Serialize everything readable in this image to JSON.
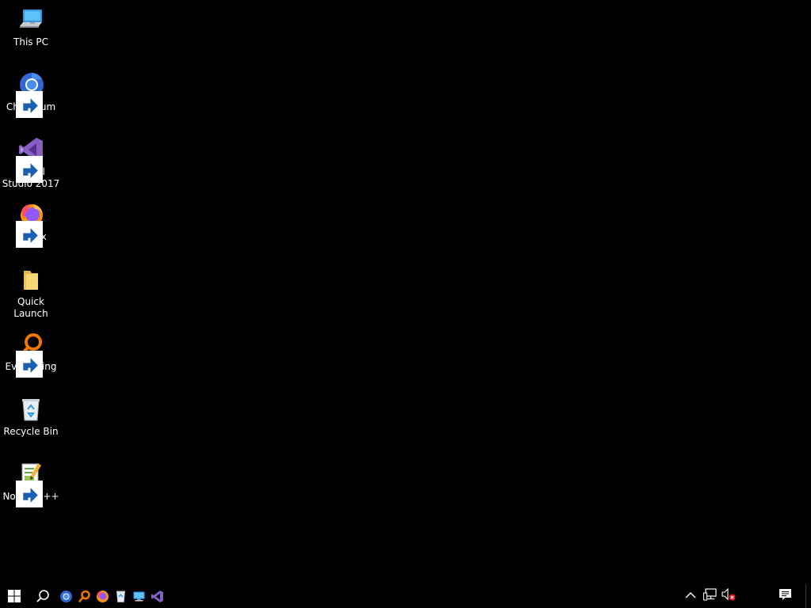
{
  "desktop": {
    "icons": [
      {
        "id": "this-pc",
        "label": "This PC",
        "icon": "computer-icon"
      },
      {
        "id": "chromium",
        "label": "Chromium",
        "icon": "chromium-icon"
      },
      {
        "id": "visual-studio",
        "label": "Visual Studio 2017",
        "icon": "visual-studio-icon"
      },
      {
        "id": "firefox",
        "label": "Firefox",
        "icon": "firefox-icon"
      },
      {
        "id": "quick-launch",
        "label": "Quick Launch",
        "icon": "folder-icon"
      },
      {
        "id": "everything",
        "label": "Everything",
        "icon": "everything-icon"
      },
      {
        "id": "recycle-bin",
        "label": "Recycle Bin",
        "icon": "recycle-bin-icon"
      },
      {
        "id": "notepadpp",
        "label": "Notepad++",
        "icon": "notepad-plus-plus-icon"
      }
    ]
  },
  "taskbar": {
    "start": {
      "icon": "windows-logo-icon"
    },
    "search": {
      "icon": "search-icon"
    },
    "pinned": [
      {
        "id": "chromium",
        "icon": "chromium-icon"
      },
      {
        "id": "everything",
        "icon": "everything-icon"
      },
      {
        "id": "firefox",
        "icon": "firefox-icon"
      },
      {
        "id": "recycle-bin",
        "icon": "recycle-bin-icon"
      },
      {
        "id": "this-pc",
        "icon": "computer-icon"
      },
      {
        "id": "visual-studio",
        "icon": "visual-studio-icon"
      }
    ],
    "tray": [
      {
        "id": "show-hidden",
        "icon": "chevron-up-icon"
      },
      {
        "id": "network",
        "icon": "network-icon"
      },
      {
        "id": "volume",
        "icon": "volume-muted-icon"
      }
    ],
    "action_center": {
      "icon": "notification-icon"
    }
  },
  "colors": {
    "background": "#000000",
    "chromium_blue": "#4a8df0",
    "vs_purple": "#865fc5",
    "everything_orange": "#f07800",
    "folder_yellow": "#f8d775"
  }
}
